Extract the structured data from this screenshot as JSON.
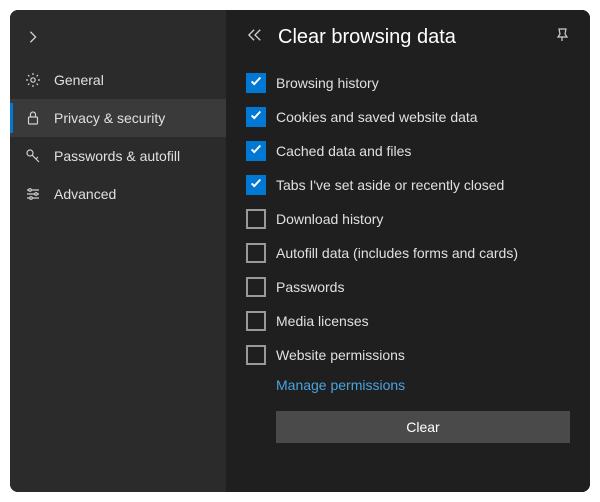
{
  "sidebar": {
    "items": [
      {
        "label": "General",
        "icon": "gear"
      },
      {
        "label": "Privacy & security",
        "icon": "lock"
      },
      {
        "label": "Passwords & autofill",
        "icon": "key"
      },
      {
        "label": "Advanced",
        "icon": "sliders"
      }
    ]
  },
  "header": {
    "title": "Clear browsing data"
  },
  "options": [
    {
      "label": "Browsing history",
      "checked": true
    },
    {
      "label": "Cookies and saved website data",
      "checked": true
    },
    {
      "label": "Cached data and files",
      "checked": true
    },
    {
      "label": "Tabs I've set aside or recently closed",
      "checked": true
    },
    {
      "label": "Download history",
      "checked": false
    },
    {
      "label": "Autofill data (includes forms and cards)",
      "checked": false
    },
    {
      "label": "Passwords",
      "checked": false
    },
    {
      "label": "Media licenses",
      "checked": false
    },
    {
      "label": "Website permissions",
      "checked": false
    }
  ],
  "manage_link": "Manage permissions",
  "clear_button": "Clear"
}
